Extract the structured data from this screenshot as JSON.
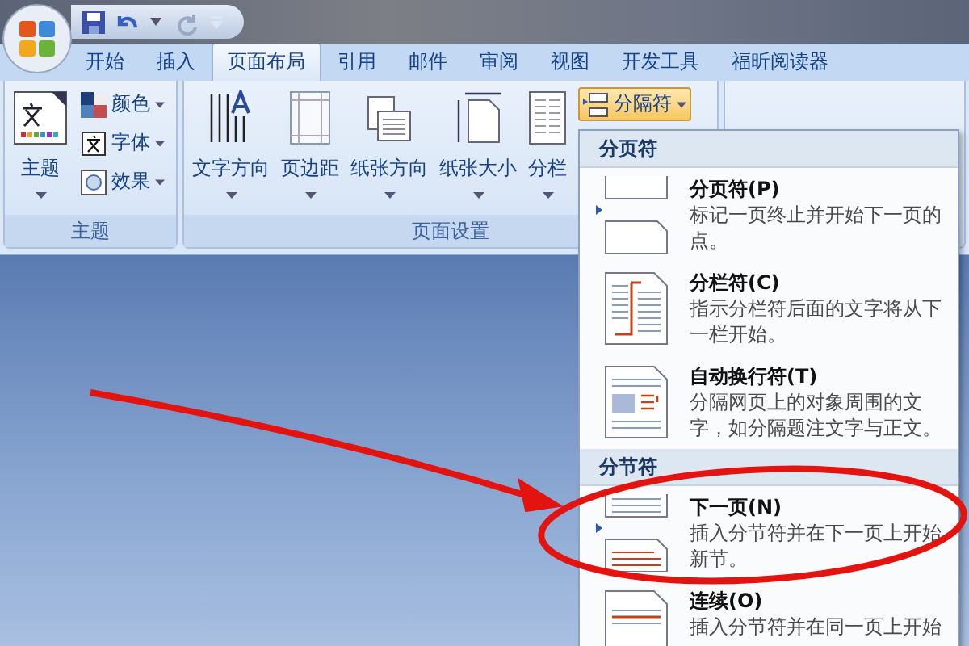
{
  "tabs": [
    {
      "label": "开始",
      "selected": false
    },
    {
      "label": "插入",
      "selected": false
    },
    {
      "label": "页面布局",
      "selected": true
    },
    {
      "label": "引用",
      "selected": false
    },
    {
      "label": "邮件",
      "selected": false
    },
    {
      "label": "审阅",
      "selected": false
    },
    {
      "label": "视图",
      "selected": false
    },
    {
      "label": "开发工具",
      "selected": false
    },
    {
      "label": "福昕阅读器",
      "selected": false
    }
  ],
  "ribbon": {
    "groups": [
      {
        "label": "主题",
        "large_buttons": [
          {
            "label": "主题",
            "kind": "theme"
          }
        ],
        "small_buttons": [
          {
            "label": "颜色",
            "kind": "colors",
            "open": false
          },
          {
            "label": "字体",
            "kind": "fonts",
            "open": false
          },
          {
            "label": "效果",
            "kind": "effects",
            "open": false
          }
        ]
      },
      {
        "label": "页面设置",
        "large_buttons": [
          {
            "label": "文字方向",
            "kind": "text-direction"
          },
          {
            "label": "页边距",
            "kind": "margins"
          },
          {
            "label": "纸张方向",
            "kind": "orientation"
          },
          {
            "label": "纸张大小",
            "kind": "size"
          },
          {
            "label": "分栏",
            "kind": "columns"
          }
        ],
        "small_buttons": [
          {
            "label": "分隔符",
            "kind": "breaks",
            "open": true
          }
        ]
      }
    ]
  },
  "breaks_menu": {
    "sections": [
      {
        "heading": "分页符",
        "items": [
          {
            "kind": "page",
            "title": "分页符(P)",
            "description": "标记一页终止并开始下一页的点。"
          },
          {
            "kind": "column",
            "title": "分栏符(C)",
            "description": "指示分栏符后面的文字将从下一栏开始。"
          },
          {
            "kind": "wrap",
            "title": "自动换行符(T)",
            "description": "分隔网页上的对象周围的文字，如分隔题注文字与正文。"
          }
        ]
      },
      {
        "heading": "分节符",
        "items": [
          {
            "kind": "next",
            "title": "下一页(N)",
            "description": "插入分节符并在下一页上开始新节。"
          },
          {
            "kind": "continuous",
            "title": "连续(O)",
            "description": "插入分节符并在同一页上开始"
          }
        ]
      }
    ]
  }
}
